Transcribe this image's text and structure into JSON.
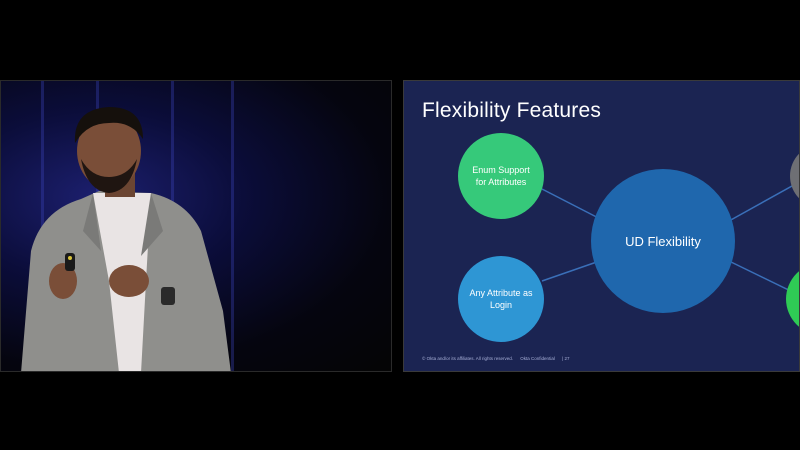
{
  "slide": {
    "title": "Flexibility Features",
    "center_node": "UD Flexibility",
    "nodes": [
      {
        "label": "Enum Support for Attributes",
        "color": "#36c97a"
      },
      {
        "label": "Any Attribute as Login",
        "color": "#2e96d4"
      }
    ],
    "center_color": "#1f67ad",
    "footer": {
      "copyright": "© Okta and/or its affiliates. All rights reserved.",
      "confidential": "Okta Confidential",
      "page": "| 27"
    }
  }
}
